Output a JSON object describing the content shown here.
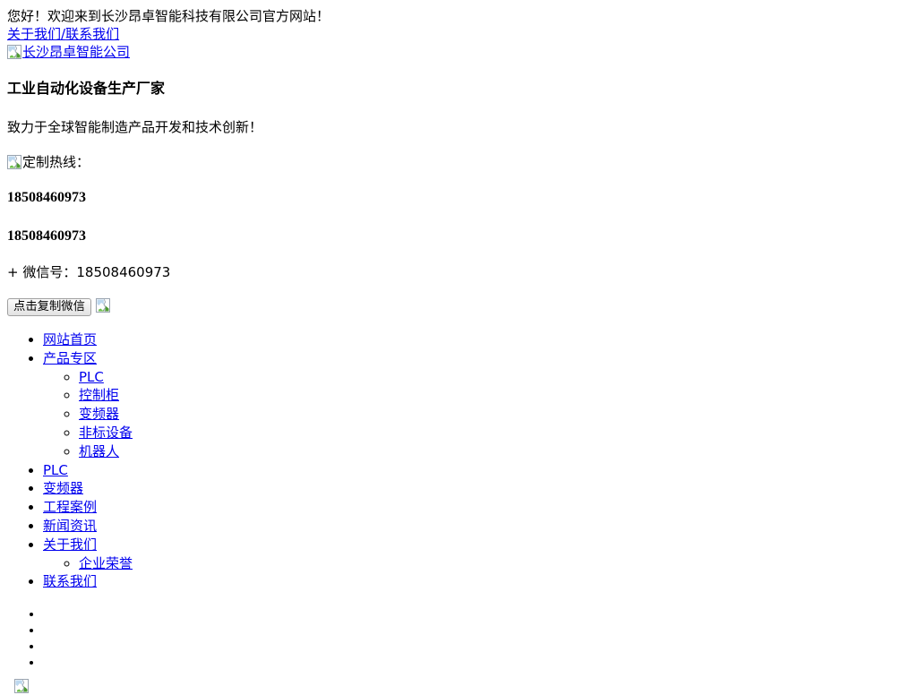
{
  "page": {
    "welcome": "您好！欢迎来到长沙昂卓智能科技有限公司官方网站！",
    "background_color": "#ffffff",
    "link_color": "#0000ee",
    "text_color": "#000000"
  },
  "topbar": {
    "about_label": "关于我们",
    "separator": "/",
    "contact_label": "联系我们"
  },
  "logo": {
    "alt": "长沙昂卓智能公司",
    "icon": "broken-image-icon"
  },
  "hero": {
    "heading": "工业自动化设备生产厂家",
    "subheading": "致力于全球智能制造产品开发和技术创新！"
  },
  "hotline": {
    "icon": "broken-image-icon",
    "label": "定制热线：",
    "phone_primary": "18508460973",
    "phone_secondary": "18508460973"
  },
  "wechat": {
    "prefix": "+",
    "label": "微信号：18508460973",
    "copy_button": "点击复制微信",
    "qr_icon": "broken-image-icon"
  },
  "nav": {
    "items": [
      {
        "label": "网站首页",
        "children": []
      },
      {
        "label": "产品专区",
        "children": [
          {
            "label": "PLC"
          },
          {
            "label": "控制柜"
          },
          {
            "label": "变频器"
          },
          {
            "label": "非标设备"
          },
          {
            "label": "机器人"
          }
        ]
      },
      {
        "label": "PLC",
        "children": []
      },
      {
        "label": "变频器",
        "children": []
      },
      {
        "label": "工程案例",
        "children": []
      },
      {
        "label": "新闻资讯",
        "children": []
      },
      {
        "label": "关于我们",
        "children": [
          {
            "label": "企业荣誉"
          }
        ]
      },
      {
        "label": "联系我们",
        "children": []
      }
    ]
  },
  "social": {
    "items": [
      {
        "label": ""
      },
      {
        "label": ""
      },
      {
        "label": ""
      },
      {
        "label": ""
      }
    ]
  },
  "bottom": {
    "icon": "broken-image-icon"
  }
}
